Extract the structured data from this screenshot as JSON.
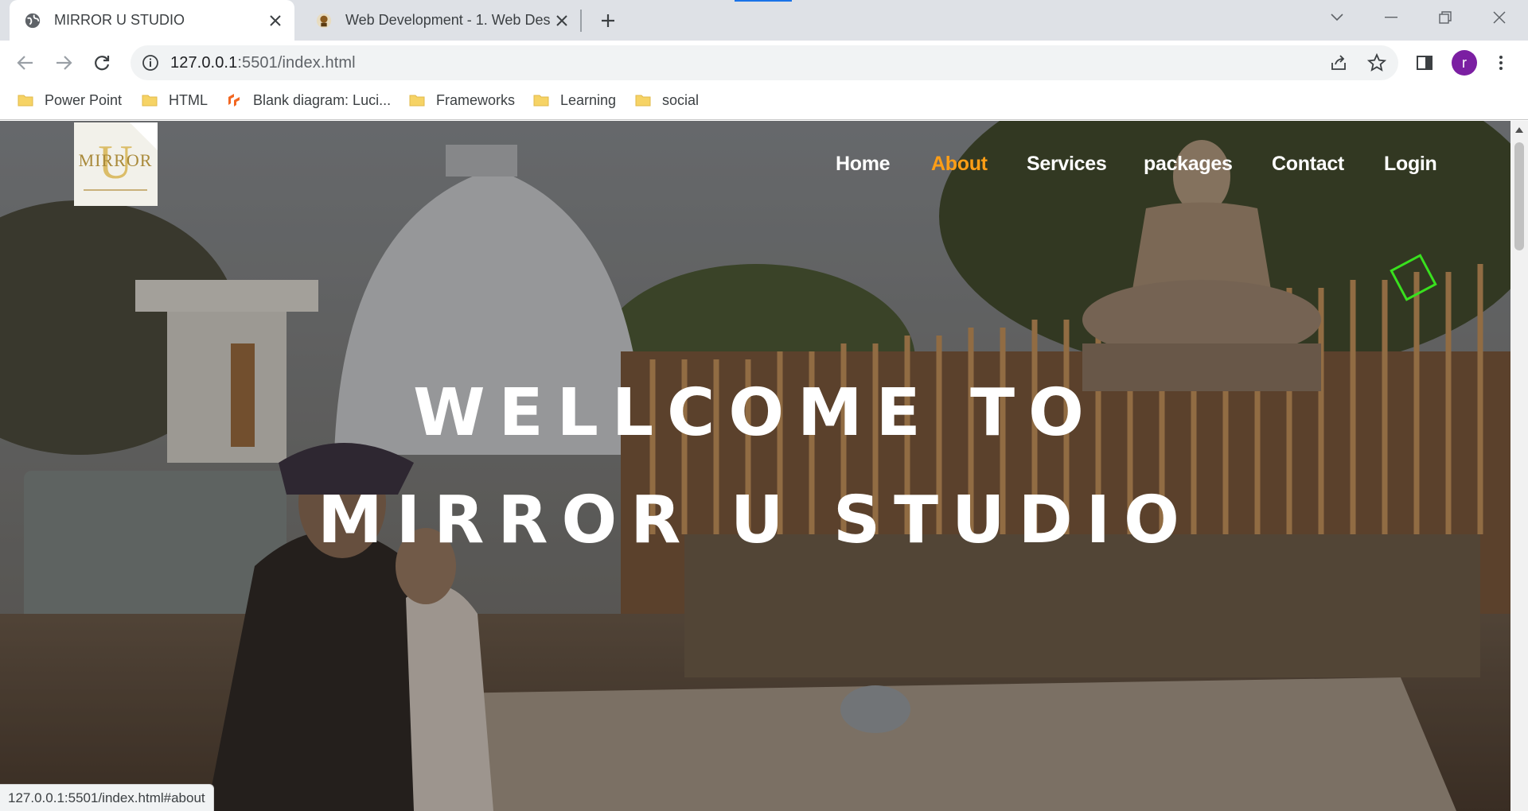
{
  "browser": {
    "tabs": [
      {
        "title": "MIRROR U STUDIO",
        "active": true,
        "favicon": "globe-icon"
      },
      {
        "title": "Web Development - 1. Web Desi",
        "active": false,
        "favicon": "site-favicon-icon"
      }
    ],
    "url_host": "127.0.0.1",
    "url_rest": ":5501/index.html",
    "profile_initial": "r",
    "bookmarks": [
      {
        "label": "Power Point",
        "icon": "folder-icon"
      },
      {
        "label": "HTML",
        "icon": "folder-icon"
      },
      {
        "label": "Blank diagram: Luci...",
        "icon": "lucid-icon"
      },
      {
        "label": "Frameworks",
        "icon": "folder-icon"
      },
      {
        "label": "Learning",
        "icon": "folder-icon"
      },
      {
        "label": "social",
        "icon": "folder-icon"
      }
    ],
    "status_url": "127.0.0.1:5501/index.html#about"
  },
  "site": {
    "logo_text": "MIRROR",
    "logo_letter": "U",
    "nav": [
      {
        "label": "Home",
        "active": false
      },
      {
        "label": "About",
        "active": true
      },
      {
        "label": "Services",
        "active": false
      },
      {
        "label": "packages",
        "active": false
      },
      {
        "label": "Contact",
        "active": false
      },
      {
        "label": "Login",
        "active": false
      }
    ],
    "headline_line1": "WELLCOME TO",
    "headline_line2": "MIRROR U STUDIO"
  },
  "colors": {
    "nav_active": "#ff9e16",
    "profile": "#7b1fa2",
    "diamond": "#39e01e",
    "tab_accent": "#1a73e8"
  }
}
